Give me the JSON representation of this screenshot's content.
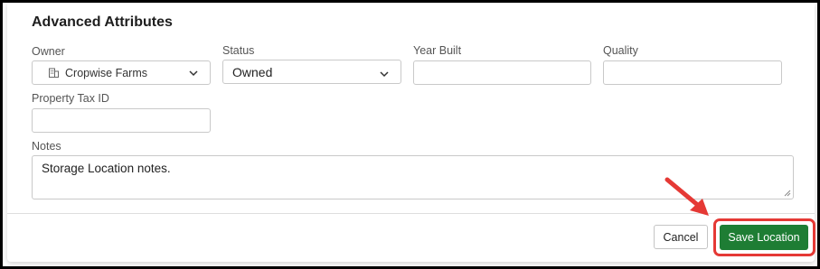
{
  "section": {
    "title": "Advanced Attributes"
  },
  "owner": {
    "label": "Owner",
    "value": "Cropwise Farms",
    "icon": "building-icon"
  },
  "status": {
    "label": "Status",
    "value": "Owned"
  },
  "year_built": {
    "label": "Year Built",
    "value": ""
  },
  "quality": {
    "label": "Quality",
    "value": ""
  },
  "property_tax_id": {
    "label": "Property Tax ID",
    "value": ""
  },
  "notes": {
    "label": "Notes",
    "value": "Storage Location notes."
  },
  "footer": {
    "cancel_label": "Cancel",
    "save_label": "Save Location"
  },
  "colors": {
    "primary": "#1e7d34",
    "annotation": "#e53935"
  }
}
